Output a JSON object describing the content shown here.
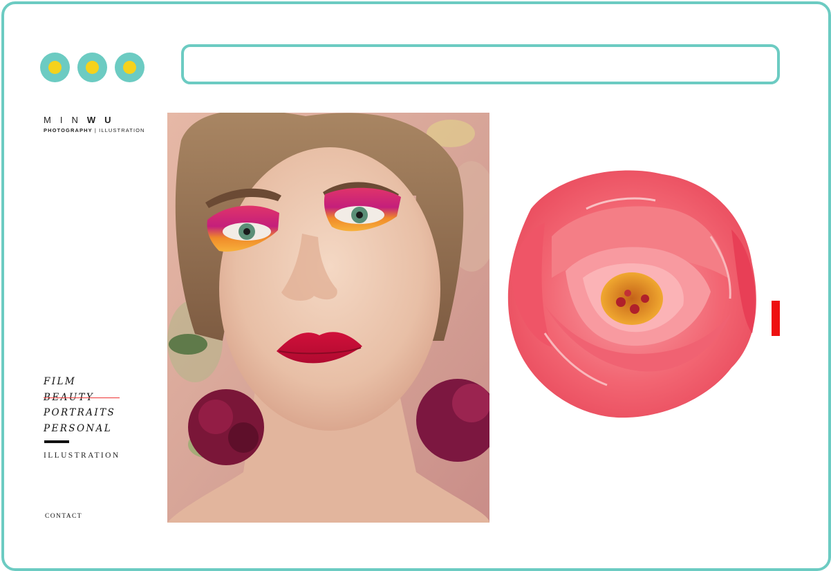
{
  "browser": {
    "window_buttons": [
      "window-dot-1",
      "window-dot-2",
      "window-dot-3"
    ],
    "address_value": ""
  },
  "brand": {
    "name_light": "MIN",
    "name_bold": "WU",
    "subtitle_bold": "PHOTOGRAPHY",
    "subtitle_sep": "|",
    "subtitle_rest": "ILLUSTRATION"
  },
  "nav": {
    "items": [
      "FILM",
      "BEAUTY",
      "PORTRAITS",
      "PERSONAL"
    ],
    "active": "BEAUTY",
    "illustration": "ILLUSTRATION",
    "contact": "CONTACT"
  },
  "colors": {
    "frame": "#6ccbc2",
    "dot_inner": "#f5d21c",
    "accent_red": "#ee1111"
  }
}
